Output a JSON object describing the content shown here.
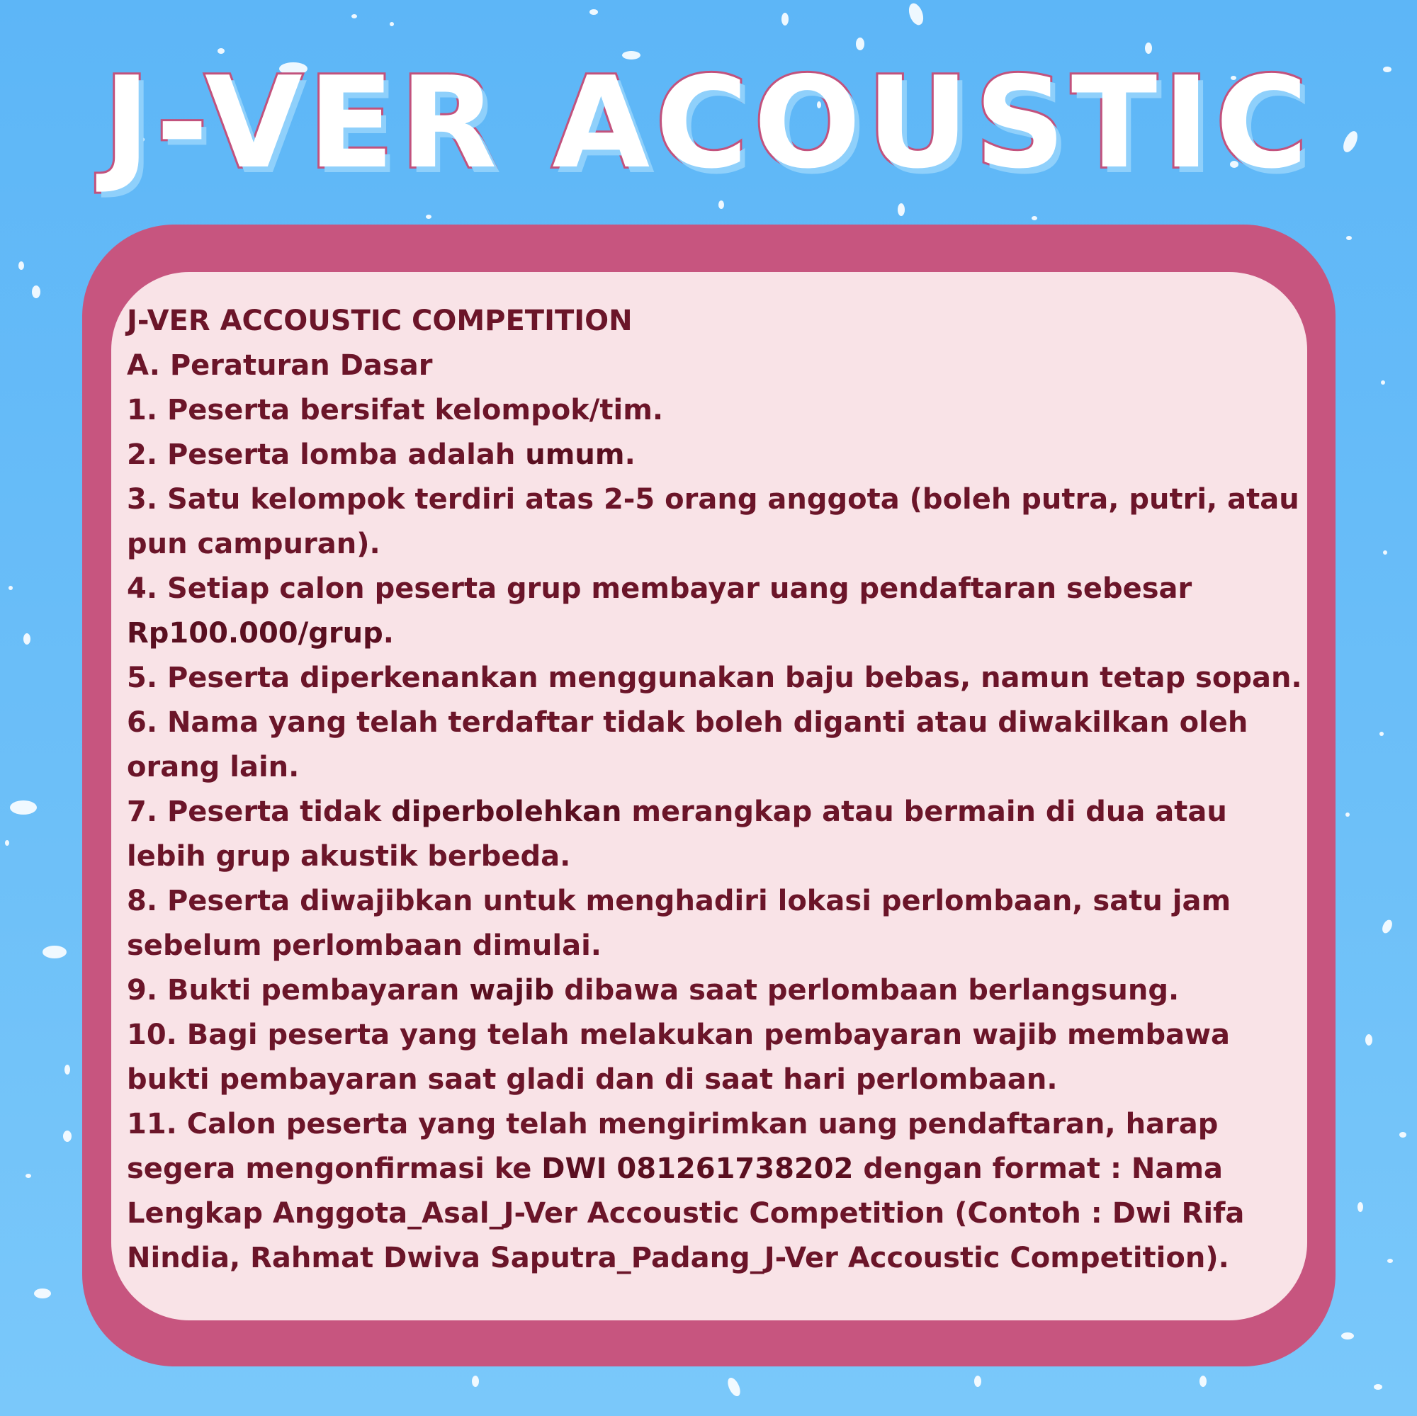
{
  "header": {
    "title": "J-VER ACOUSTIC"
  },
  "rules": {
    "heading": "J-VER ACCOUSTIC COMPETITION",
    "section": "A. Peraturan Dasar",
    "r1": "1. Peserta bersifat kelompok/tim.",
    "r2_a": "2. Peserta lomba adalah ",
    "r2_b": "umum",
    "r2_c": ".",
    "r3_l1": "3. Satu kelompok terdiri atas 2-5 orang anggota (boleh putra, putri, atau",
    "r3_l2": "pun campuran).",
    "r4_l1": "4. Setiap calon peserta grup membayar uang pendaftaran sebesar",
    "r4_l2_a": "Rp100.000/grup",
    "r4_l2_b": ".",
    "r5": "5. Peserta diperkenankan menggunakan baju bebas, namun tetap sopan.",
    "r6_l1": "6. Nama yang telah terdaftar tidak boleh diganti atau diwakilkan oleh",
    "r6_l2": "orang lain.",
    "r7_l1_a": "7. Peserta tidak ",
    "r7_l1_b": "diperbolehkan",
    "r7_l1_c": " merangkap atau bermain di dua atau",
    "r7_l2": "lebih grup akustik berbeda.",
    "r8_l1": "8. Peserta diwajibkan untuk menghadiri lokasi perlombaan, satu jam",
    "r8_l2": "sebelum perlombaan dimulai.",
    "r9_a": "9. Bukti pembayaran ",
    "r9_b": "wajib",
    "r9_c": " dibawa saat perlombaan berlangsung.",
    "r10_l1": "10. Bagi peserta yang telah melakukan pembayaran wajib membawa",
    "r10_l2": "bukti pembayaran saat gladi dan di saat hari perlombaan.",
    "r11_l1": "11. Calon peserta yang telah mengirimkan uang pendaftaran, harap",
    "r11_l2_a": "segera mengonfirmasi ke ",
    "r11_l2_b": "DWI 081261738202",
    "r11_l2_c": " dengan format : Nama",
    "r11_l3": "Lengkap Anggota_Asal_J-Ver Accoustic Competition (Contoh : Dwi Rifa",
    "r11_l4": "Nindia, Rahmat Dwiva Saputra_Padang_J-Ver Accoustic Competition)."
  },
  "colors": {
    "background": "#5db6f7",
    "card_frame": "#c7557f",
    "card_fill": "#f9e3e7",
    "text": "#6b1529",
    "title_fill": "#ffffff",
    "title_outline": "#c2527d"
  }
}
